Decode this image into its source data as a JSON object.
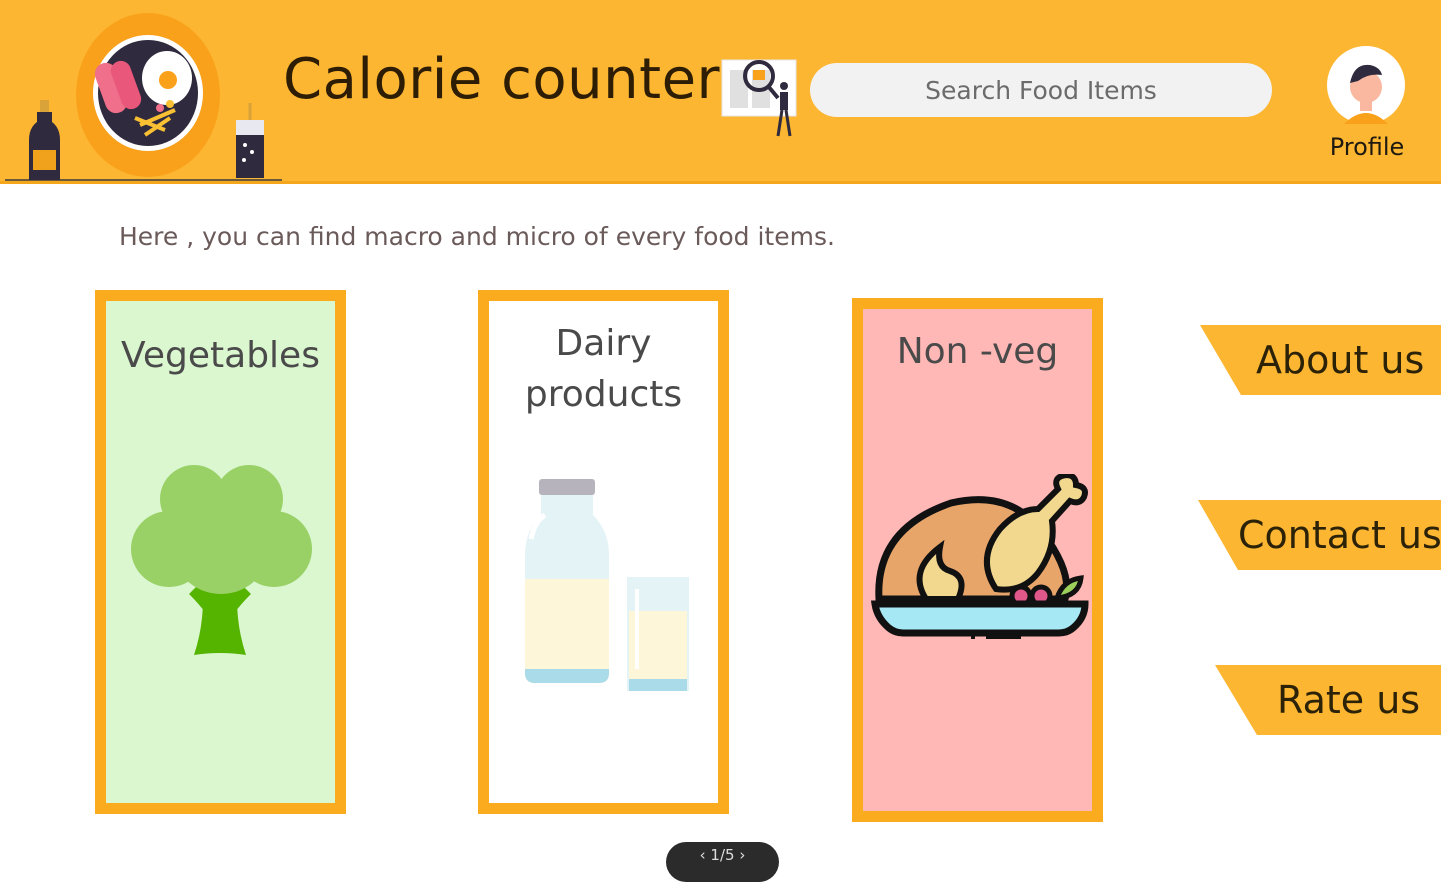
{
  "header": {
    "title": "Calorie counter",
    "search_placeholder": "Search Food Items",
    "profile_label": "Profile"
  },
  "tagline": "Here , you can find macro and micro of every food items.",
  "categories": [
    {
      "label": "Vegetables",
      "icon": "broccoli-icon",
      "color": "#dbf7d0"
    },
    {
      "label_line1": "Dairy",
      "label_line2": "products",
      "icon": "milk-bottle-icon",
      "color": "#ffffff"
    },
    {
      "label": "Non -veg",
      "icon": "roast-chicken-icon",
      "color": "#ffb8b6"
    }
  ],
  "nav": {
    "about": "About us",
    "contact": "Contact us",
    "rate": "Rate us"
  },
  "pager": "1/5",
  "colors": {
    "header": "#fcb631",
    "card_border": "#fbac1e",
    "nav_tab": "#fcb631"
  }
}
